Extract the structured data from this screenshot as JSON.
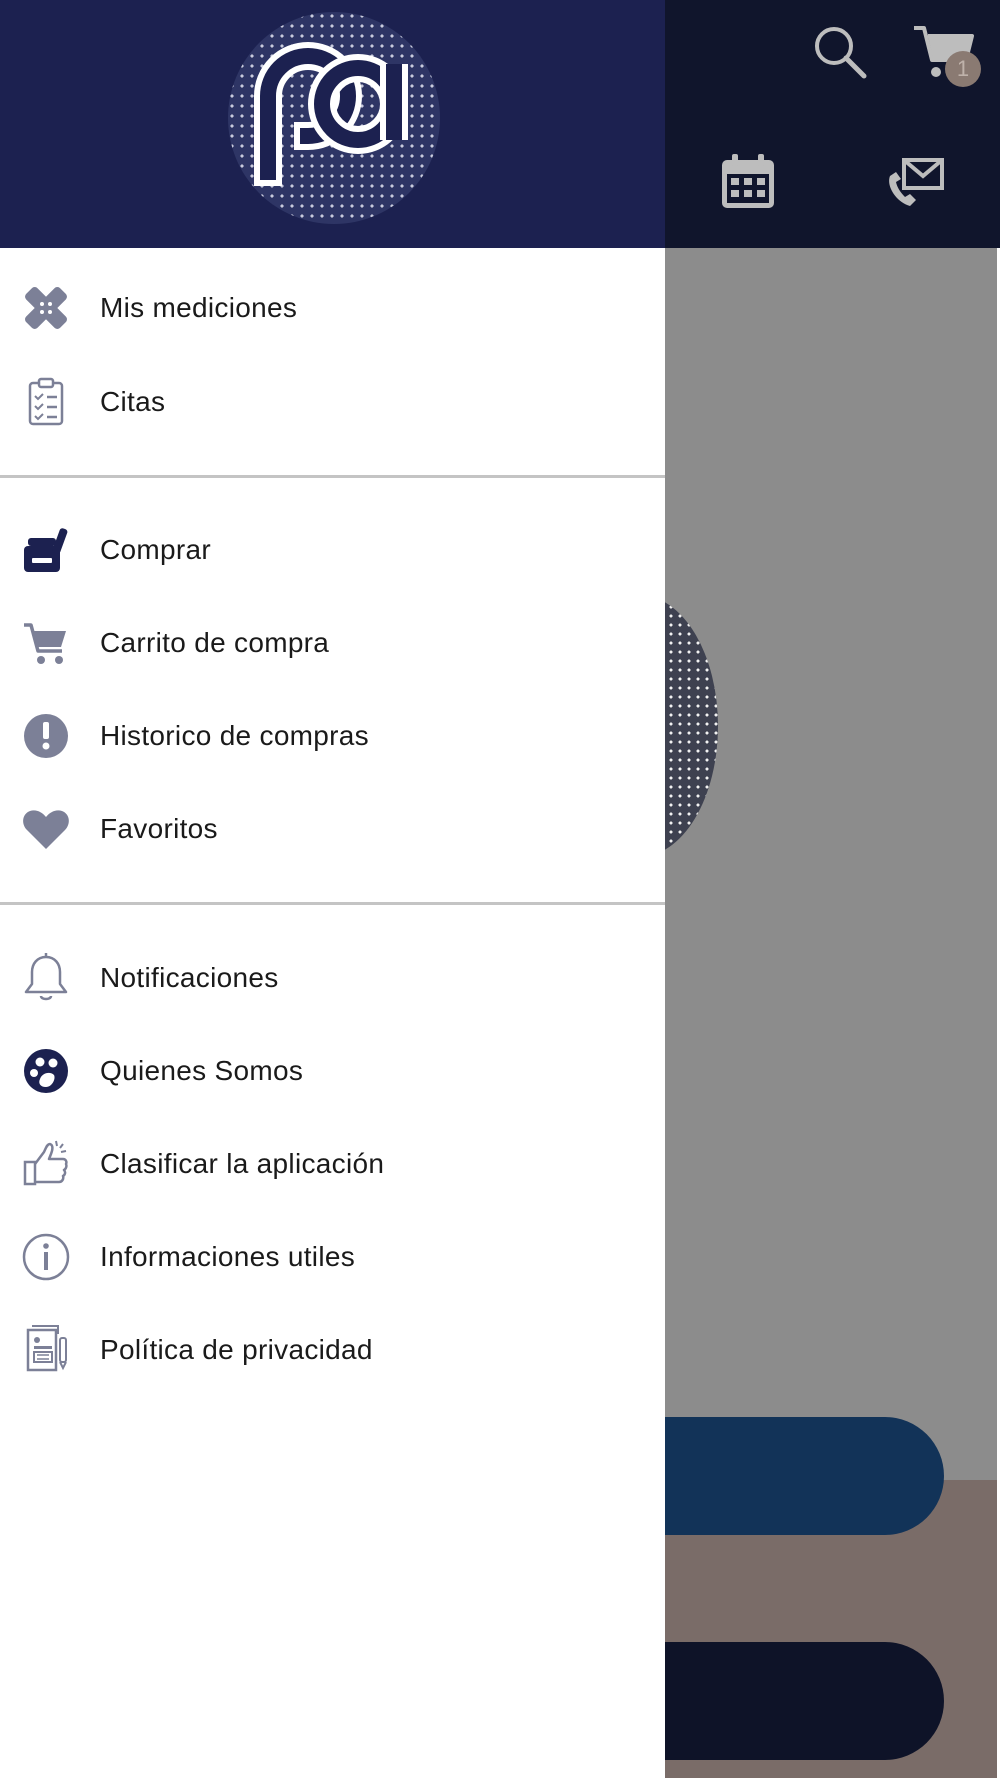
{
  "header": {
    "cart_badge": "1",
    "logo_text": "pd"
  },
  "menu": {
    "section1": [
      {
        "label": "Mis mediciones",
        "icon": "bandage-icon"
      },
      {
        "label": "Citas",
        "icon": "clipboard-checklist-icon"
      }
    ],
    "section2": [
      {
        "label": "Comprar",
        "icon": "jar-shop-icon"
      },
      {
        "label": "Carrito de compra",
        "icon": "cart-icon"
      },
      {
        "label": "Historico de compras",
        "icon": "exclamation-circle-icon"
      },
      {
        "label": "Favoritos",
        "icon": "heart-icon"
      }
    ],
    "section3": [
      {
        "label": "Notificaciones",
        "icon": "bell-icon"
      },
      {
        "label": "Quienes Somos",
        "icon": "people-circle-icon"
      },
      {
        "label": "Clasificar la aplicación",
        "icon": "thumbs-up-icon"
      },
      {
        "label": "Informaciones utiles",
        "icon": "info-icon"
      },
      {
        "label": "Política de privacidad",
        "icon": "privacy-document-icon"
      }
    ]
  },
  "colors": {
    "drawer_header": "#1c2150",
    "app_header": "#10152c",
    "overlay": "#8c8c8c",
    "icon_gray": "#7c8097",
    "icon_navy": "#1c2150"
  }
}
